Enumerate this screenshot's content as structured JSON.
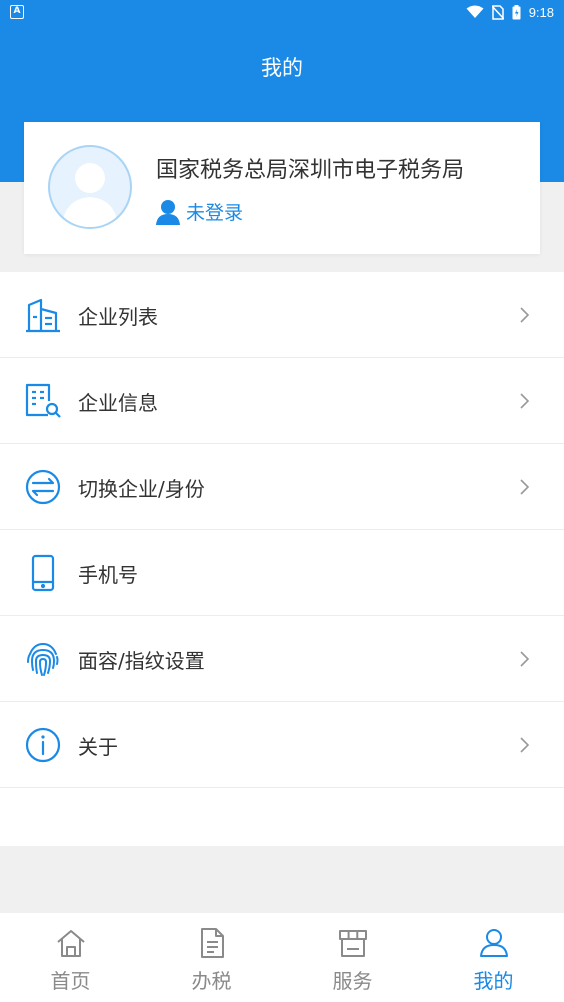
{
  "status_bar": {
    "time": "9:18",
    "app_icon_letter": "A"
  },
  "header": {
    "title": "我的"
  },
  "profile": {
    "org_name": "国家税务总局深圳市电子税务局",
    "login_status": "未登录"
  },
  "menu": {
    "items": [
      {
        "label": "企业列表",
        "icon": "building-icon",
        "has_chevron": true
      },
      {
        "label": "企业信息",
        "icon": "company-info-icon",
        "has_chevron": true
      },
      {
        "label": "切换企业/身份",
        "icon": "switch-icon",
        "has_chevron": true
      },
      {
        "label": "手机号",
        "icon": "phone-icon",
        "has_chevron": false
      },
      {
        "label": "面容/指纹设置",
        "icon": "fingerprint-icon",
        "has_chevron": true
      },
      {
        "label": "关于",
        "icon": "info-icon",
        "has_chevron": true
      }
    ]
  },
  "tabbar": {
    "tabs": [
      {
        "label": "首页",
        "icon": "home-icon",
        "active": false
      },
      {
        "label": "办税",
        "icon": "document-icon",
        "active": false
      },
      {
        "label": "服务",
        "icon": "store-icon",
        "active": false
      },
      {
        "label": "我的",
        "icon": "user-icon",
        "active": true
      }
    ]
  },
  "colors": {
    "primary": "#1a8ae6",
    "text": "#333333",
    "inactive": "#8a8a8a",
    "background": "#f0f0f0"
  }
}
